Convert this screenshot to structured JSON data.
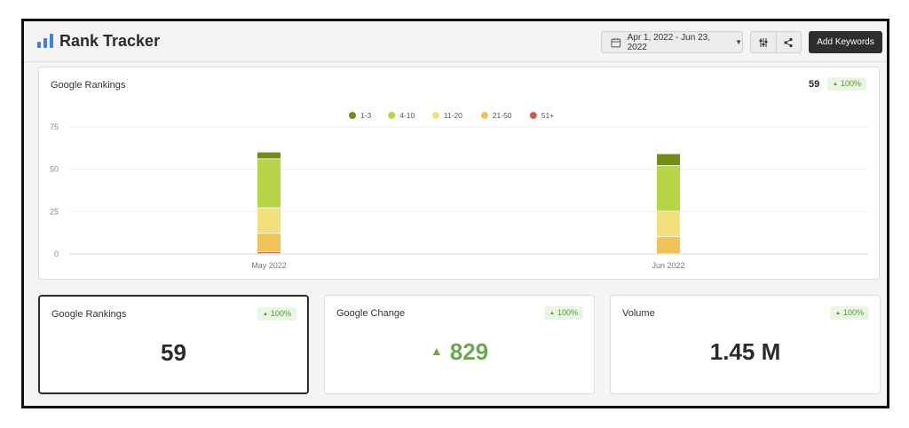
{
  "header": {
    "title": "Rank Tracker",
    "date_range": "Apr 1, 2022 - Jun 23, 2022",
    "add_keywords_label": "Add Keywords",
    "icons": [
      "bar-chart-logo-icon",
      "calendar-icon",
      "chevron-down-icon",
      "filter-sliders-icon",
      "share-icon"
    ]
  },
  "chart_card": {
    "title": "Google Rankings",
    "total": "59",
    "change": "100%"
  },
  "chart_data": {
    "type": "bar",
    "stacked": true,
    "categories": [
      "May 2022",
      "Jun 2022"
    ],
    "series": [
      {
        "name": "51+",
        "color": "#d35a4f",
        "values": [
          1,
          0
        ]
      },
      {
        "name": "21-50",
        "color": "#f1c357",
        "values": [
          11,
          10
        ]
      },
      {
        "name": "11-20",
        "color": "#f3de7c",
        "values": [
          15,
          15
        ]
      },
      {
        "name": "4-10",
        "color": "#b6d645",
        "values": [
          29,
          27
        ]
      },
      {
        "name": "1-3",
        "color": "#6f8e12",
        "values": [
          4,
          7
        ]
      }
    ],
    "legend_order": [
      "1-3",
      "4-10",
      "11-20",
      "21-50",
      "51+"
    ],
    "y_ticks": [
      0,
      25,
      50,
      75
    ],
    "ylim": [
      0,
      75
    ],
    "legend_position": "top-center",
    "grid": true
  },
  "stats": [
    {
      "title": "Google Rankings",
      "badge": "100%",
      "value": "59",
      "selected": true
    },
    {
      "title": "Google Change",
      "badge": "100%",
      "value": "829",
      "trend": "up"
    },
    {
      "title": "Volume",
      "badge": "100%",
      "value": "1.45 M"
    }
  ],
  "colors": {
    "accent_green": "#6aa84f",
    "badge_bg": "#eaf5e4",
    "button_dark": "#2e2e2e",
    "logo_blue": "#3f7fe0"
  }
}
